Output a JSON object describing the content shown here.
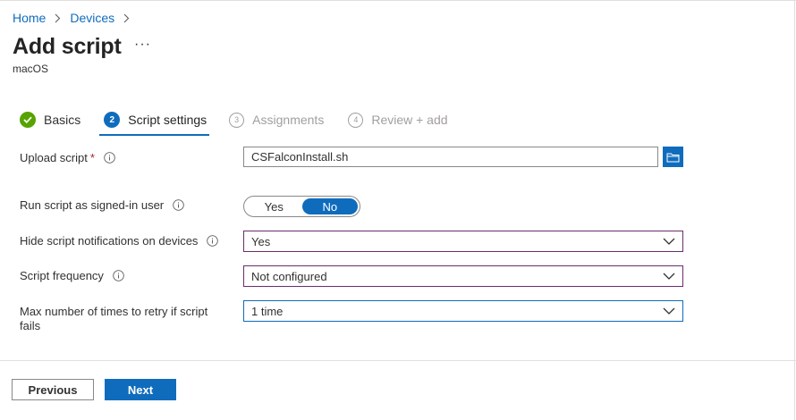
{
  "breadcrumb": {
    "home": "Home",
    "devices": "Devices"
  },
  "page": {
    "title": "Add script",
    "more": "···",
    "subtitle": "macOS"
  },
  "steps": [
    {
      "number": "",
      "label": "Basics",
      "state": "done"
    },
    {
      "number": "2",
      "label": "Script settings",
      "state": "active"
    },
    {
      "number": "3",
      "label": "Assignments",
      "state": "pending"
    },
    {
      "number": "4",
      "label": "Review + add",
      "state": "pending"
    }
  ],
  "form": {
    "upload_script": {
      "label": "Upload script",
      "required": "*",
      "value": "CSFalconInstall.sh"
    },
    "run_as_user": {
      "label": "Run script as signed-in user",
      "yes": "Yes",
      "no": "No",
      "selected": "No"
    },
    "hide_notifications": {
      "label": "Hide script notifications on devices",
      "value": "Yes"
    },
    "frequency": {
      "label": "Script frequency",
      "value": "Not configured"
    },
    "max_retries": {
      "label_line1": "Max number of times to retry if script",
      "label_line2": "fails",
      "value": "1 time"
    }
  },
  "footer": {
    "previous": "Previous",
    "next": "Next"
  },
  "colors": {
    "accent": "#0f6cbd",
    "success": "#57a300",
    "required": "#a4262c",
    "dropdown_border": "#6b2c6e"
  }
}
